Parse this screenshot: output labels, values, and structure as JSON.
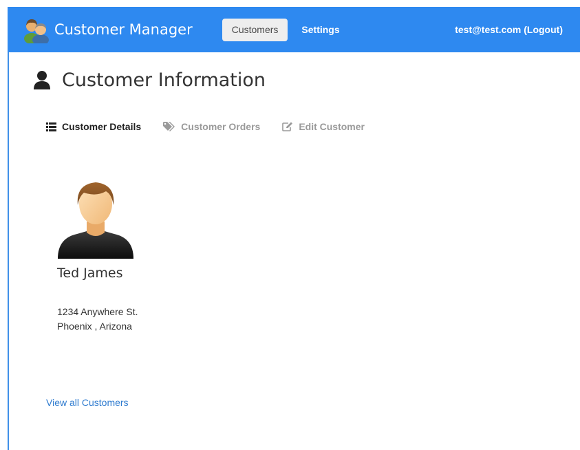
{
  "navbar": {
    "brand_name": "Customer Manager",
    "brand_logo_icon": "users-group-icon",
    "tabs": [
      {
        "label": "Customers",
        "active": true
      },
      {
        "label": "Settings",
        "active": false
      }
    ],
    "user_text": "test@test.com (Logout)",
    "background_color": "#2e89f0"
  },
  "header": {
    "icon": "person-icon",
    "title": "Customer Information"
  },
  "sub_tabs": [
    {
      "label": "Customer Details",
      "icon": "list-icon",
      "active": true
    },
    {
      "label": "Customer Orders",
      "icon": "tags-icon",
      "active": false
    },
    {
      "label": "Edit Customer",
      "icon": "edit-icon",
      "active": false
    }
  ],
  "customer": {
    "avatar_icon": "male-avatar-icon",
    "name": "Ted James",
    "address_line1": "1234 Anywhere St.",
    "address_line2": "Phoenix , Arizona"
  },
  "footer": {
    "view_all_label": "View all Customers",
    "link_color": "#2e7bcf"
  }
}
